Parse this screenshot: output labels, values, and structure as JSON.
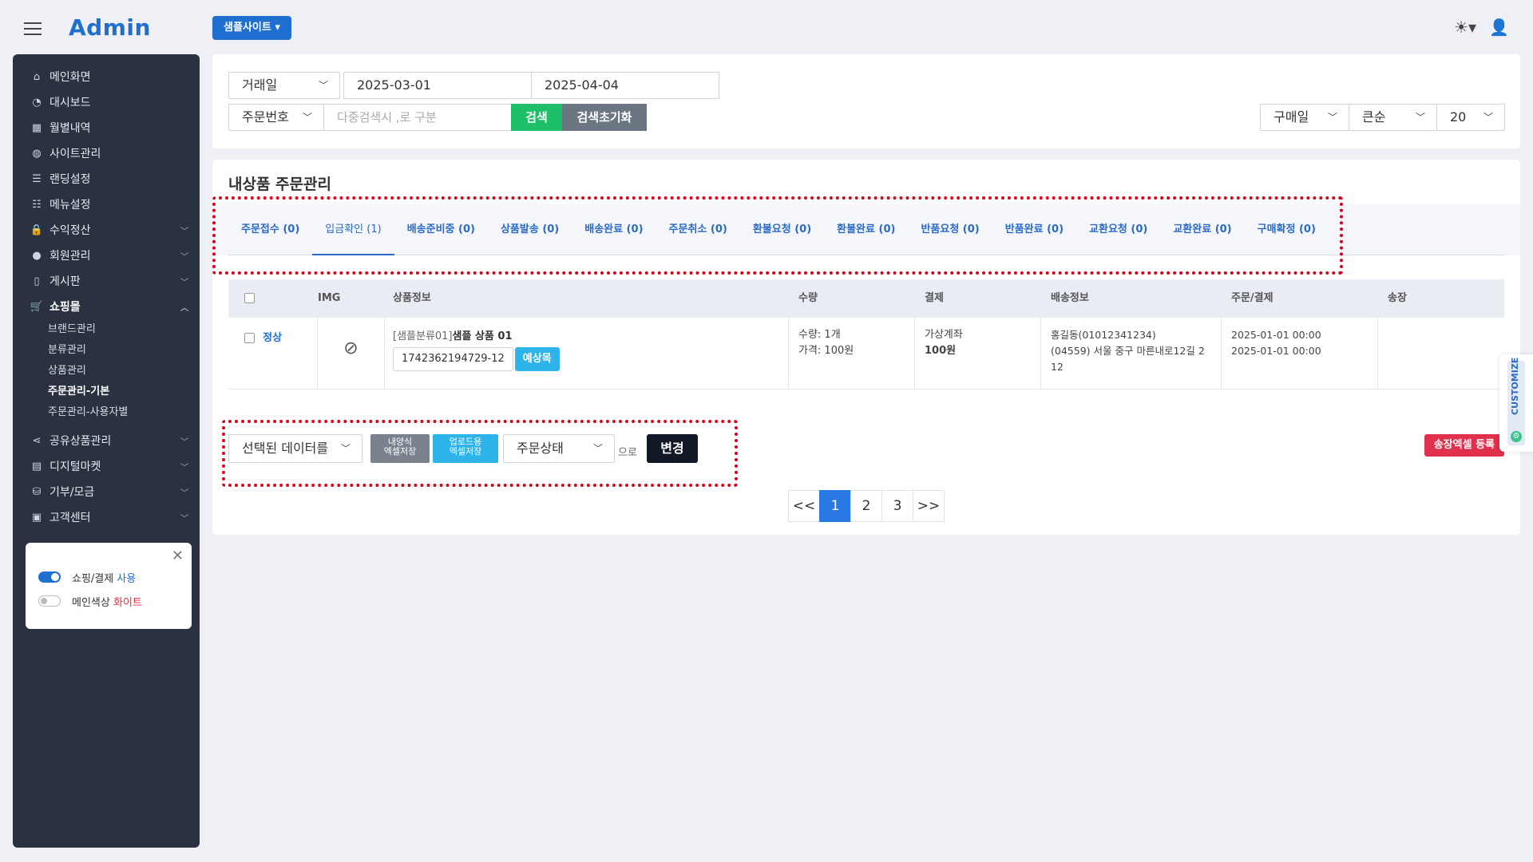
{
  "header": {
    "logo": "Admin",
    "site_button": "샘플사이트 ▾",
    "theme_icon": "sun-icon",
    "user_icon": "user-icon"
  },
  "sidebar": {
    "items": [
      {
        "label": "메인화면",
        "icon": "home-icon"
      },
      {
        "label": "대시보드",
        "icon": "pie-chart-icon"
      },
      {
        "label": "월별내역",
        "icon": "calendar-icon"
      },
      {
        "label": "사이트관리",
        "icon": "globe-icon"
      },
      {
        "label": "랜딩설정",
        "icon": "list-icon"
      },
      {
        "label": "메뉴설정",
        "icon": "menu-list-icon"
      },
      {
        "label": "수익정산",
        "icon": "lock-icon"
      },
      {
        "label": "회원관리",
        "icon": "user-icon"
      },
      {
        "label": "게시판",
        "icon": "clipboard-icon"
      },
      {
        "label": "쇼핑몰",
        "icon": "cart-icon"
      }
    ],
    "shop_sub": [
      "브랜드관리",
      "분류관리",
      "상품관리",
      "주문관리-기본",
      "주문관리-사용자별"
    ],
    "items_after": [
      {
        "label": "공유상품관리",
        "icon": "share-icon"
      },
      {
        "label": "디지털마켓",
        "icon": "file-icon"
      },
      {
        "label": "기부/모금",
        "icon": "coins-icon"
      },
      {
        "label": "고객센터",
        "icon": "briefcase-icon"
      }
    ]
  },
  "settings_card": {
    "row1_label": "쇼핑/결제",
    "row1_value": "사용",
    "row2_label": "메인색상",
    "row2_value": "화이트"
  },
  "filter": {
    "date_type": "거래일",
    "date_from": "2025-03-01",
    "date_to": "2025-04-04",
    "search_field": "주문번호",
    "search_placeholder": "다중검색시 ,로 구분",
    "search_button": "검색",
    "reset_button": "검색초기화",
    "sort_field": "구매일",
    "sort_order": "큰순",
    "page_size": "20"
  },
  "main": {
    "title": "내상품 주문관리",
    "tabs": [
      "주문접수 (0)",
      "입금확인 (1)",
      "배송준비중 (0)",
      "상품발송 (0)",
      "배송완료 (0)",
      "주문취소 (0)",
      "환불요청 (0)",
      "환불완료 (0)",
      "반품요청 (0)",
      "반품완료 (0)",
      "교환요청 (0)",
      "교환완료 (0)",
      "구매확정 (0)"
    ],
    "active_tab": 1,
    "table_headers": {
      "img": "IMG",
      "info": "상품정보",
      "qty": "수량",
      "pay": "결제",
      "ship": "배송정보",
      "date": "주문/결제",
      "inv": "송장"
    },
    "row": {
      "status": "정상",
      "category": "[샘플분류01]",
      "product": "샘플 상품 01",
      "order_no": "1742362194729-12",
      "reserve_button": "예상목",
      "qty_line": "수량: 1개",
      "price_line": "가격: 100원",
      "pay_method": "가상계좌",
      "pay_amount": "100원",
      "ship_name": "홍길동(01012341234)",
      "ship_addr1": "(04559) 서울 중구 마른내로12길 2",
      "ship_addr2": "12",
      "order_date": "2025-01-01 00:00",
      "pay_date": "2025-01-01 00:00"
    },
    "bulk": {
      "select_label": "선택된 데이터를",
      "btn1_line1": "내양식",
      "btn1_line2": "엑셀저장",
      "btn2_line1": "업로드용",
      "btn2_line2": "엑셀저장",
      "status_select": "주문상태",
      "suffix": "으로",
      "change_button": "변경"
    },
    "invoice_button": "송장엑셀 등록",
    "pager": [
      "<<",
      "1",
      "2",
      "3",
      ">>"
    ],
    "active_page": "1"
  },
  "customize_label": "CUSTOMIZE",
  "colors": {
    "primary": "#1f6fd1",
    "sidebar_bg": "#2a3242",
    "search_green": "#1fbf6a",
    "reset_gray": "#6c7683",
    "highlight_red": "#d6001c",
    "invoice_red": "#e0304b",
    "reserve_cyan": "#2fb4ea"
  }
}
